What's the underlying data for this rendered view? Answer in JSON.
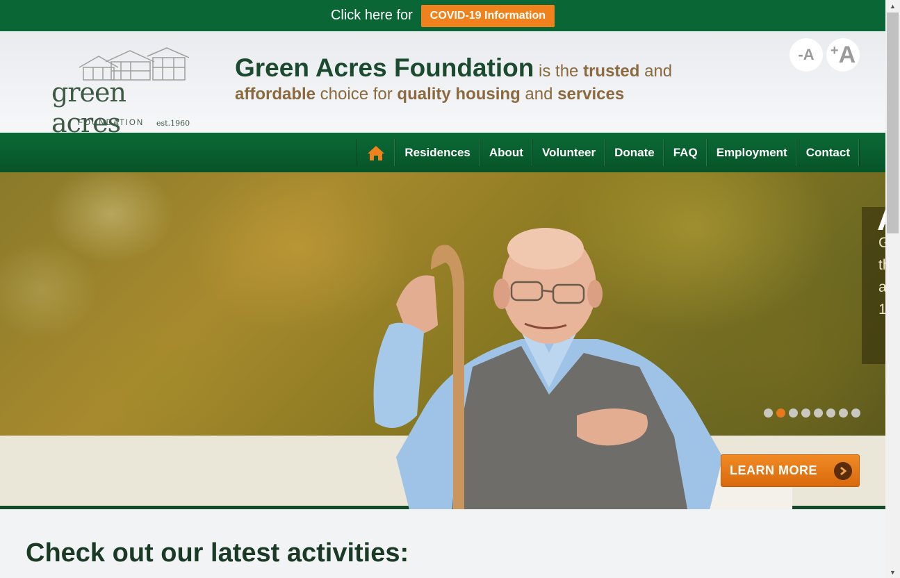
{
  "alert": {
    "text": "Click here for",
    "button_label": "COVID-19 Information"
  },
  "logo": {
    "wordmark": "green acres",
    "subtitle": "FOUNDATION",
    "established": "est.1960"
  },
  "tagline": {
    "name": "Green Acres Foundation",
    "part1": " is the ",
    "trusted": "trusted",
    "part2": " and",
    "affordable": "affordable",
    "part3": " choice for ",
    "quality_housing": "quality housing",
    "part4": " and ",
    "services": "services"
  },
  "font_controls": {
    "decrease": "-A",
    "increase_sign": "+",
    "increase_letter": "A"
  },
  "nav": {
    "home_icon": "home-icon",
    "items": [
      "Residences",
      "About",
      "Volunteer",
      "Donate",
      "FAQ",
      "Employment",
      "Contact"
    ]
  },
  "hero": {
    "caption_title": "A",
    "caption_lines": [
      "G",
      "th",
      "a",
      "1"
    ],
    "slide_count": 8,
    "active_slide": 2,
    "learn_more_label": "LEARN MORE"
  },
  "section": {
    "title": "Check out our latest activities:"
  },
  "colors": {
    "brand_green": "#0a6635",
    "accent_orange": "#f0821e",
    "tagline_brown": "#8a6a3e"
  }
}
